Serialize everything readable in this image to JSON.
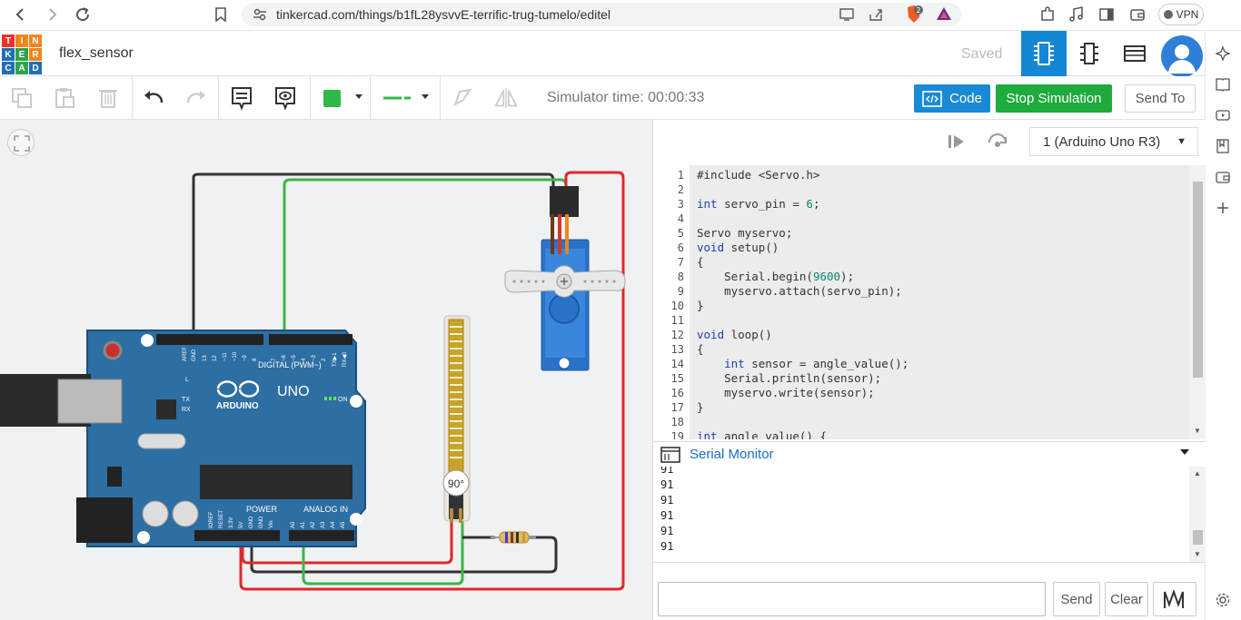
{
  "browser": {
    "url": "tinkercad.com/things/b1fL28ysvvE-terrific-trug-tumelo/editel",
    "vpn_label": "VPN",
    "brave_badge": "2"
  },
  "app": {
    "logo_letters": [
      "T",
      "I",
      "N",
      "K",
      "E",
      "R",
      "C",
      "A",
      "D"
    ],
    "project_title": "flex_sensor",
    "saved_status": "Saved"
  },
  "toolbar": {
    "simulator_time": "Simulator time: 00:00:33",
    "code_label": "Code",
    "stop_label": "Stop Simulation",
    "send_to_label": "Send To",
    "fill_color": "#2fb84a"
  },
  "canvas": {
    "flex_angle": "90°",
    "board_labels": {
      "digital": "DIGITAL (PWM~)",
      "arduino": "ARDUINO",
      "uno": "UNO",
      "power": "POWER",
      "analog": "ANALOG IN",
      "on": "ON",
      "l": "L",
      "tx": "TX",
      "rx": "RX",
      "aref": "AREF",
      "gnd": "GND",
      "pins_digital": [
        "13",
        "12",
        "~11",
        "~10",
        "~9",
        "8",
        "7",
        "~6",
        "~5",
        "4",
        "~3",
        "2",
        "TX▶1",
        "RX◀0"
      ],
      "pins_power": [
        "IOREF",
        "RESET",
        "3.3V",
        "5V",
        "GND",
        "GND",
        "Vin"
      ],
      "pins_analog": [
        "A0",
        "A1",
        "A2",
        "A3",
        "A4",
        "A5"
      ]
    }
  },
  "code_panel": {
    "board_select": "1 (Arduino Uno R3)",
    "lines": [
      "#include <Servo.h>",
      "",
      "int servo_pin = 6;",
      "",
      "Servo myservo;",
      "void setup()",
      "{",
      "    Serial.begin(9600);",
      "    myservo.attach(servo_pin);",
      "}",
      "",
      "void loop()",
      "{",
      "    int sensor = angle_value();",
      "    Serial.println(sensor);",
      "    myservo.write(sensor);",
      "}",
      "",
      "int angle value() {"
    ],
    "line_numbers": [
      "1",
      "2",
      "3",
      "4",
      "5",
      "6",
      "7",
      "8",
      "9",
      "10",
      "11",
      "12",
      "13",
      "14",
      "15",
      "16",
      "17",
      "18",
      "19"
    ],
    "serial_monitor_title": "Serial Monitor",
    "serial_output": [
      "91",
      "91",
      "91",
      "91",
      "91",
      "91"
    ],
    "send_label": "Send",
    "clear_label": "Clear"
  }
}
